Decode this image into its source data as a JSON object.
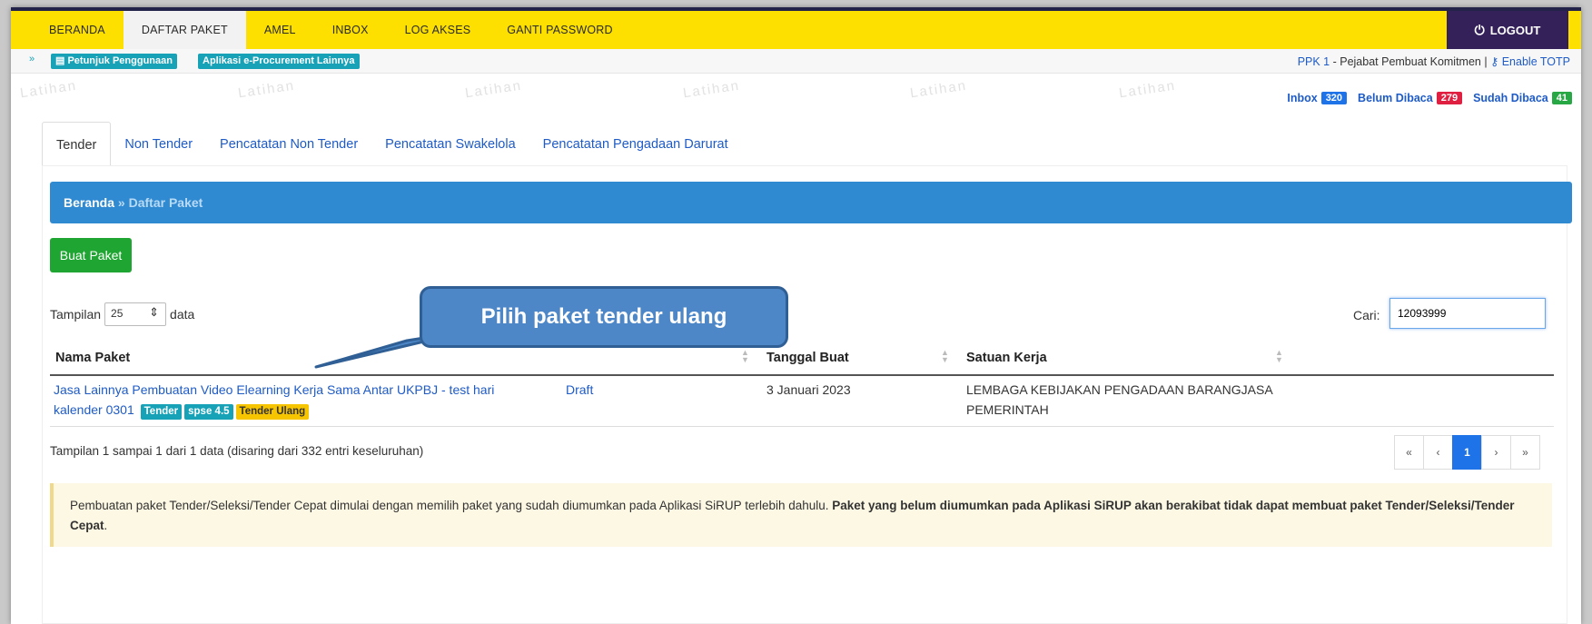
{
  "nav": {
    "items": [
      {
        "label": "BERANDA",
        "active": false
      },
      {
        "label": "DAFTAR PAKET",
        "active": true
      },
      {
        "label": "AMEL",
        "active": false
      },
      {
        "label": "INBOX",
        "active": false
      },
      {
        "label": "LOG AKSES",
        "active": false
      },
      {
        "label": "GANTI PASSWORD",
        "active": false
      }
    ],
    "logout": "LOGOUT"
  },
  "subbar": {
    "help": "Petunjuk Penggunaan",
    "other_apps": "Aplikasi e-Procurement Lainnya",
    "user_role": "PPK 1",
    "user_desc": " - Pejabat Pembuat Komitmen | ",
    "totp": "Enable TOTP"
  },
  "messages": {
    "inbox_label": "Inbox",
    "inbox_count": "320",
    "unread_label": "Belum Dibaca",
    "unread_count": "279",
    "read_label": "Sudah Dibaca",
    "read_count": "41"
  },
  "watermark": "Latihan",
  "tabs": [
    "Tender",
    "Non Tender",
    "Pencatatan Non Tender",
    "Pencatatan Swakelola",
    "Pencatatan Pengadaan Darurat"
  ],
  "breadcrumb": {
    "home": "Beranda",
    "sep": " » ",
    "current": "Daftar Paket"
  },
  "create_button": "Buat Paket",
  "length": {
    "prefix": "Tampilan",
    "value": "25",
    "suffix": "data"
  },
  "search": {
    "label": "Cari:",
    "value": "12093999"
  },
  "table": {
    "headers": [
      "Nama Paket",
      "Tanggal Buat",
      "Satuan Kerja"
    ],
    "row": {
      "name_line1": "Jasa Lainnya Pembuatan Video Elearning Kerja Sama Antar UKPBJ - test hari",
      "name_line2": "kalender 0301",
      "tags": [
        "Tender",
        "spse 4.5",
        "Tender Ulang"
      ],
      "status": "Draft",
      "date": "3 Januari 2023",
      "unit_line1": "LEMBAGA KEBIJAKAN PENGADAAN BARANGJASA",
      "unit_line2": "PEMERINTAH"
    }
  },
  "info": "Tampilan 1 sampai 1 dari 1 data (disaring dari 332 entri keseluruhan)",
  "pager": [
    "«",
    "‹",
    "1",
    "›",
    "»"
  ],
  "alert": {
    "normal": "Pembuatan paket Tender/Seleksi/Tender Cepat dimulai dengan memilih paket yang sudah diumumkan pada Aplikasi SiRUP terlebih dahulu. ",
    "bold": "Paket yang belum diumumkan pada Aplikasi SiRUP akan berakibat tidak dapat membuat paket Tender/Seleksi/Tender Cepat",
    "end": "."
  },
  "callout": "Pilih paket tender ulang"
}
